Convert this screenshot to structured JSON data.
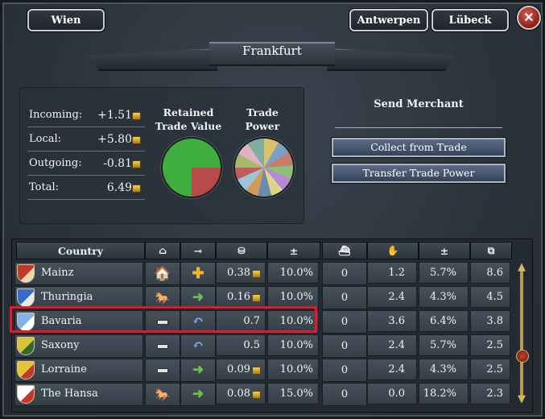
{
  "tabs": {
    "left": "Wien",
    "right1": "Antwerpen",
    "right2": "Lübeck",
    "close_icon": "close-x-icon"
  },
  "title": "Frankfurt",
  "stats": [
    {
      "label": "Incoming:",
      "value": "+1.51"
    },
    {
      "label": "Local:",
      "value": "+5.80"
    },
    {
      "label": "Outgoing:",
      "value": "-0.81"
    },
    {
      "label": "Total:",
      "value": "6.49"
    }
  ],
  "retained": {
    "label_line1": "Retained",
    "label_line2": "Trade Value",
    "retained_fraction": 0.25,
    "colors": [
      "#3fae3f",
      "#b84a4a"
    ]
  },
  "trade_power": {
    "label": "Trade Power"
  },
  "merchant": {
    "title": "Send Merchant",
    "collect": "Collect from Trade",
    "transfer": "Transfer Trade Power"
  },
  "table": {
    "headers": {
      "country": "Country",
      "col_building_icon": "house-icon",
      "col_arrow_icon": "arrow-right-icon",
      "col_coins_icon": "coins-icon",
      "pm1": "±",
      "col_ship_icon": "ship-icon",
      "col_handshake_icon": "handshake-icon",
      "pm2": "±",
      "col_boxes_icon": "boxes-icon"
    },
    "rows": [
      {
        "country": "Mainz",
        "c1": "house",
        "c2": "plus",
        "value": "0.38",
        "coin": true,
        "pct": "10.0%",
        "ships": "0",
        "power": "1.2",
        "share": "5.7%",
        "last": "8.6",
        "shield": [
          "#c0392b",
          "#e9d8b0"
        ]
      },
      {
        "country": "Thuringia",
        "c1": "wagon",
        "c2": "green",
        "value": "0.16",
        "coin": true,
        "pct": "10.0%",
        "ships": "0",
        "power": "2.4",
        "share": "4.3%",
        "last": "4.5",
        "shield": [
          "#3a6bc7",
          "#e9e9e9"
        ]
      },
      {
        "country": "Bavaria",
        "c1": "dash",
        "c2": "blue",
        "value": "0.7",
        "coin": false,
        "pct": "10.0%",
        "ships": "0",
        "power": "3.6",
        "share": "6.4%",
        "last": "3.8",
        "shield": [
          "#7fb3ea",
          "#ffffff"
        ]
      },
      {
        "country": "Saxony",
        "c1": "dash",
        "c2": "blue",
        "value": "0.5",
        "coin": false,
        "pct": "10.0%",
        "ships": "0",
        "power": "2.4",
        "share": "5.7%",
        "last": "2.5",
        "shield": [
          "#d8c23a",
          "#2f6a2f"
        ]
      },
      {
        "country": "Lorraine",
        "c1": "dash",
        "c2": "green",
        "value": "0.09",
        "coin": true,
        "pct": "10.0%",
        "ships": "0",
        "power": "2.4",
        "share": "4.3%",
        "last": "2.5",
        "shield": [
          "#e5c535",
          "#c0392b"
        ]
      },
      {
        "country": "The Hansa",
        "c1": "wagon",
        "c2": "green",
        "value": "0.08",
        "coin": true,
        "pct": "15.0%",
        "ships": "0",
        "power": "0.0",
        "share": "18.2%",
        "last": "2.3",
        "shield": [
          "#ffffff",
          "#c0392b"
        ]
      }
    ]
  }
}
